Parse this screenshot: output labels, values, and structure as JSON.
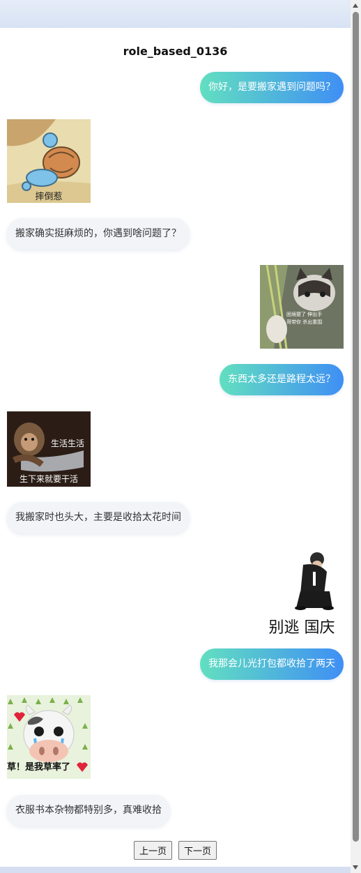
{
  "page": {
    "title": "role_based_0136"
  },
  "messages": [
    {
      "type": "text",
      "side": "right",
      "text": "你好，是要搬家遇到问题吗？"
    },
    {
      "type": "sticker",
      "side": "left",
      "icon": "squirtle-fallen-sticker",
      "caption": "摔倒惹"
    },
    {
      "type": "text",
      "side": "left",
      "text": "搬家确实挺麻烦的，你遇到啥问题了？"
    },
    {
      "type": "sticker",
      "side": "right",
      "icon": "cat-paw-sticker",
      "caption_lines": [
        "困境婴了 伸出手",
        "哥带你 杀出重围"
      ]
    },
    {
      "type": "text",
      "side": "right",
      "text": "东西太多还是路程太远？"
    },
    {
      "type": "sticker",
      "side": "left",
      "icon": "monkey-working-sticker",
      "caption_top": "生活生活",
      "caption": "生下来就要干活"
    },
    {
      "type": "text",
      "side": "left",
      "text": "我搬家时也头大，主要是收拾太花时间"
    },
    {
      "type": "sticker",
      "side": "right",
      "icon": "kneeling-man-sticker",
      "caption": "别逃 国庆"
    },
    {
      "type": "text",
      "side": "right",
      "text": "我那会儿光打包都收拾了两天"
    },
    {
      "type": "sticker",
      "side": "left",
      "icon": "crying-cow-sticker",
      "caption": "草！是我草率了"
    },
    {
      "type": "text",
      "side": "left",
      "text": "衣服书本杂物都特别多，真难收拾"
    }
  ],
  "pager": {
    "prev_label": "上一页",
    "next_label": "下一页"
  },
  "colors": {
    "bubble_gradient_start": "#62dfc0",
    "bubble_gradient_end": "#3f8ff4",
    "left_bubble_bg": "#f2f4f8"
  }
}
